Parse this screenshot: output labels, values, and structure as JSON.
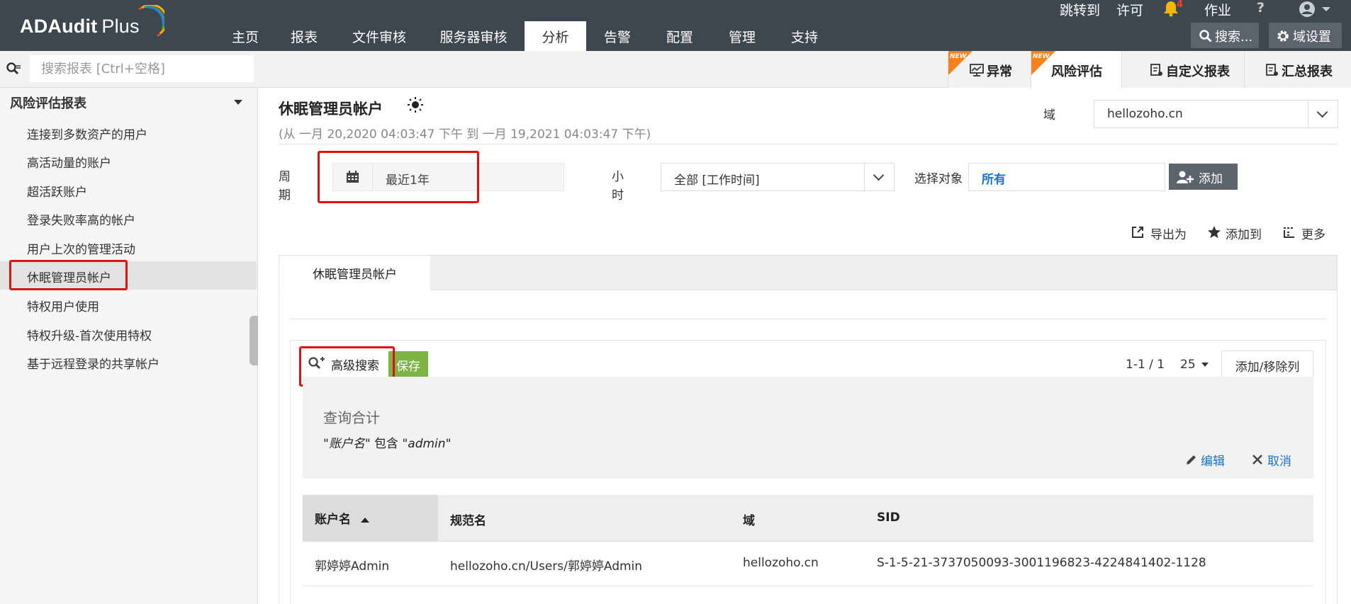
{
  "app": {
    "logo_main": "ADAudit",
    "logo_plus": "Plus"
  },
  "nav": {
    "items": [
      "主页",
      "报表",
      "文件审核",
      "服务器审核",
      "分析",
      "告警",
      "配置",
      "管理",
      "支持"
    ],
    "active": "分析"
  },
  "topright": {
    "jump": "跳转到",
    "license": "许可",
    "bell_count": "4",
    "jobs": "作业",
    "help": "?",
    "search_btn": "搜索...",
    "domain_settings": "域设置"
  },
  "search": {
    "placeholder": "搜索报表 [Ctrl+空格]"
  },
  "report_tabs": [
    {
      "label": "异常",
      "new": "NEW"
    },
    {
      "label": "风险评估",
      "new": "NEW"
    },
    {
      "label": "自定义报表"
    },
    {
      "label": "汇总报表"
    }
  ],
  "sidebar": {
    "title": "风险评估报表",
    "items": [
      "连接到多数资产的用户",
      "高活动量的账户",
      "超活跃账户",
      "登录失败率高的帐户",
      "用户上次的管理活动",
      "休眠管理员帐户",
      "特权用户使用",
      "特权升级-首次使用特权",
      "基于远程登录的共享帐户"
    ]
  },
  "report": {
    "title": "休眠管理员帐户",
    "subtitle": "(从 一月 20,2020 04:03:47 下午 到 一月 19,2021 04:03:47 下午)",
    "domain_label": "域",
    "domain_value": "hellozoho.cn",
    "period_label_1": "周",
    "period_label_2": "期",
    "period_value": "最近1年",
    "hour_label_1": "小",
    "hour_label_2": "时",
    "hour_value": "全部 [工作时间]",
    "object_label": "选择对象",
    "object_value": "所有",
    "add_button": "添加",
    "export": "导出为",
    "add_to": "添加到",
    "more": "更多"
  },
  "panel": {
    "tab": "休眠管理员帐户",
    "adv_search": "高级搜索",
    "save": "保存",
    "pager": "1-1 / 1",
    "page_size": "25",
    "columns_btn": "添加/移除列",
    "query_title": "查询合计",
    "query_q1": "\"",
    "query_field": "账户名",
    "query_q2": "\" 包含 \"",
    "query_value": "admin",
    "query_q3": "\"",
    "edit": "编辑",
    "cancel": "取消"
  },
  "table": {
    "headers": [
      "账户名",
      "规范名",
      "域",
      "SID"
    ],
    "rows": [
      [
        "郭婷婷Admin",
        "hellozoho.cn/Users/郭婷婷Admin",
        "hellozoho.cn",
        "S-1-5-21-3737050093-3001196823-4224841402-1128"
      ]
    ]
  },
  "colors": {
    "topbar": "#3d474f",
    "accent_orange": "#f5821f",
    "save_green": "#7cb342",
    "link_blue": "#1a73c8",
    "highlight_red": "#e01010"
  },
  "icons": [
    "search-icon",
    "bell-icon",
    "user-avatar-icon",
    "gear-icon",
    "calendar-icon",
    "sun-icon",
    "export-icon",
    "star-icon",
    "more-icon",
    "add-user-icon",
    "magnifier-plus-icon",
    "pencil-icon",
    "close-icon",
    "sort-up-icon"
  ]
}
